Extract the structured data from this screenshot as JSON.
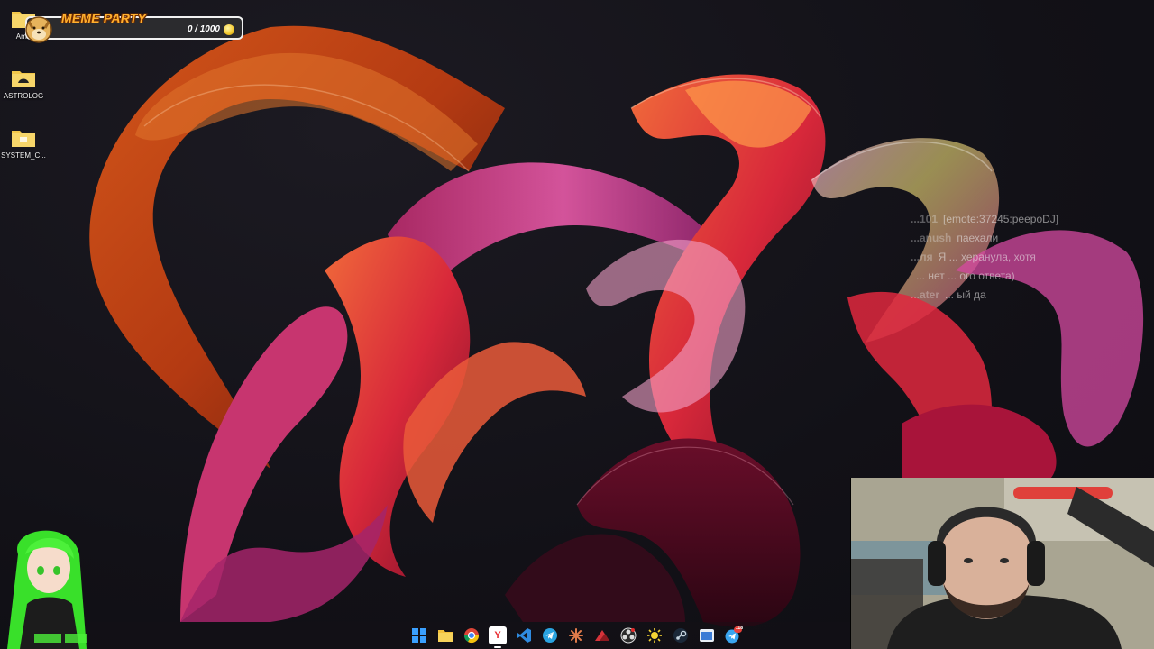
{
  "desktop": {
    "icons": [
      {
        "label": "Amn"
      },
      {
        "label": "ASTROLOG"
      },
      {
        "label": "SYSTEM_C..."
      }
    ]
  },
  "meme_party": {
    "title": "MEME PARTY",
    "score": "0 / 1000"
  },
  "chat": {
    "lines": [
      {
        "user": "...101",
        "text": "[emote:37245:peepoDJ]"
      },
      {
        "user": "...anush",
        "text": "паехали"
      },
      {
        "user": "...ля",
        "text": "Я ... херанула, хотя"
      },
      {
        "user": "",
        "text": "... нет ... ого ответа)"
      },
      {
        "user": "...ater",
        "text": "... ый да"
      }
    ]
  },
  "taskbar": {
    "icons": [
      {
        "name": "windows-start-icon",
        "color": "#3aa0ff"
      },
      {
        "name": "file-explorer-icon",
        "color": "#f3c03a"
      },
      {
        "name": "chrome-icon",
        "color": "#4caf50"
      },
      {
        "name": "yandex-browser-icon",
        "color": "#ffffff",
        "glyph": "Y"
      },
      {
        "name": "vscode-icon",
        "color": "#2f8be0"
      },
      {
        "name": "telegram-icon",
        "color": "#2aa3e0"
      },
      {
        "name": "claude-icon",
        "color": "#e07a4a"
      },
      {
        "name": "app-red-icon",
        "color": "#d6333a"
      },
      {
        "name": "obs-icon",
        "color": "#2c2c2c"
      },
      {
        "name": "sun-app-icon",
        "color": "#f6d533"
      },
      {
        "name": "steam-icon",
        "color": "#1b2838"
      },
      {
        "name": "window-app-icon",
        "color": "#e8eef5"
      },
      {
        "name": "telegram-badge-icon",
        "color": "#3aa6f0",
        "badge": "118"
      }
    ]
  }
}
